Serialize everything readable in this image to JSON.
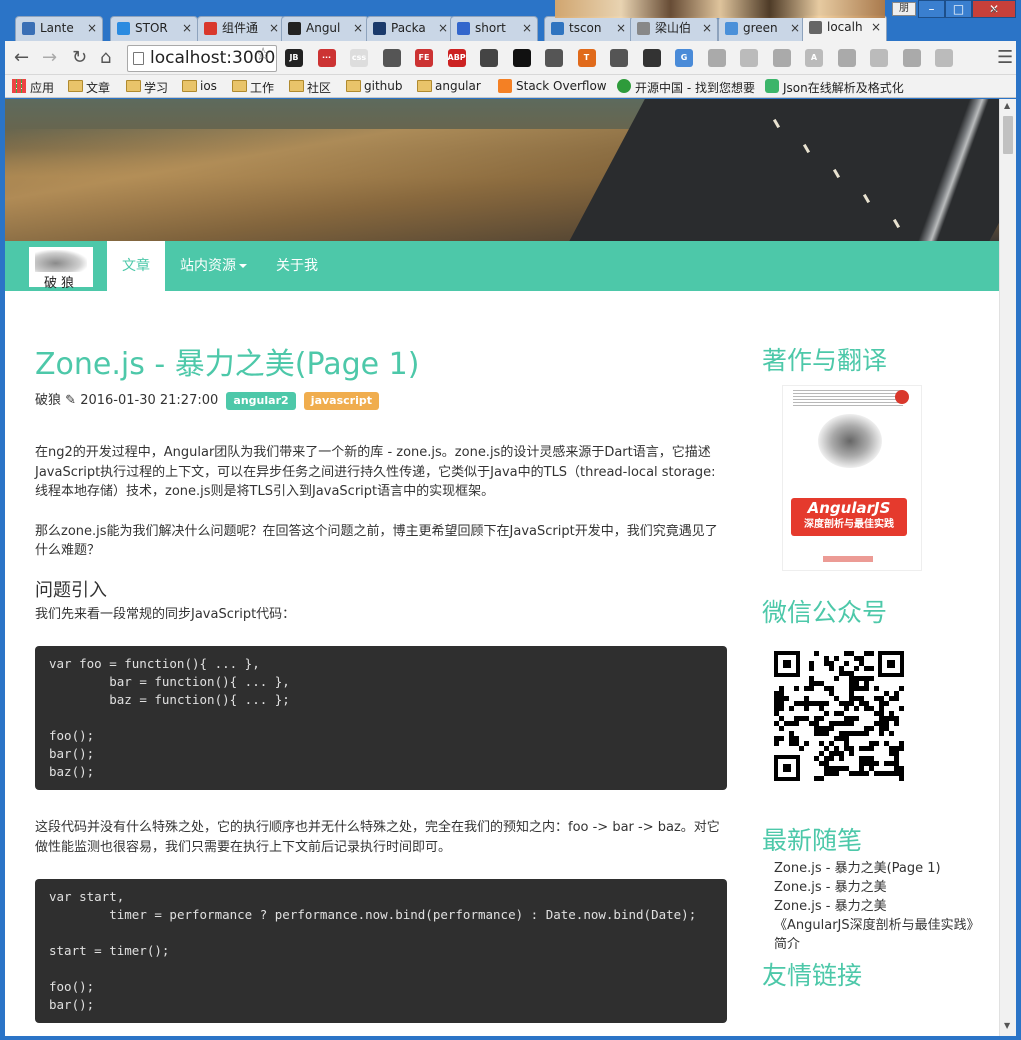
{
  "browser": {
    "tabs": [
      {
        "label": "Lante",
        "icon": "arrow-up-icon",
        "color": "#3a6fb5"
      },
      {
        "label": "STOR",
        "icon": "store-icon",
        "color": "#2b8be0"
      },
      {
        "label": "组件通",
        "icon": "angular-icon",
        "color": "#d9382c"
      },
      {
        "label": "Angul",
        "icon": "github-icon",
        "color": "#222222"
      },
      {
        "label": "Packa",
        "icon": "n-icon",
        "color": "#1b3a6b"
      },
      {
        "label": "short",
        "icon": "paw-icon",
        "color": "#3366cc"
      },
      {
        "label": "tscon",
        "icon": "ts-icon",
        "color": "#2f74c0"
      },
      {
        "label": "梁山伯",
        "icon": "page-icon",
        "color": "#888888"
      },
      {
        "label": "green",
        "icon": "c-icon",
        "color": "#4a90d9"
      },
      {
        "label": "localh",
        "icon": "wolf-icon",
        "color": "#666666"
      }
    ],
    "active_tab": 9,
    "address": "localhost:3000",
    "user_label": "朋",
    "window_buttons": {
      "min": "–",
      "max": "□",
      "close": "✕"
    },
    "bookmarks": [
      {
        "label": "应用",
        "icon": "apps-grid-icon"
      },
      {
        "label": "文章",
        "icon": "folder-icon"
      },
      {
        "label": "学习",
        "icon": "folder-icon"
      },
      {
        "label": "ios",
        "icon": "folder-icon"
      },
      {
        "label": "工作",
        "icon": "folder-icon"
      },
      {
        "label": "社区",
        "icon": "folder-icon"
      },
      {
        "label": "github",
        "icon": "folder-icon"
      },
      {
        "label": "angular",
        "icon": "folder-icon"
      },
      {
        "label": "Stack Overflow",
        "icon": "stackoverflow-icon"
      },
      {
        "label": "开源中国 - 找到您想要",
        "icon": "oschina-icon"
      },
      {
        "label": "Json在线解析及格式化",
        "icon": "json-icon"
      }
    ],
    "bookmarks_more": "»",
    "extensions": [
      "JB",
      "···",
      "css",
      "",
      "FE",
      "ABP",
      "",
      "",
      "",
      "T",
      "",
      "",
      "G",
      "",
      "",
      "",
      "A",
      "",
      "",
      "",
      ""
    ]
  },
  "site": {
    "logo_text": "破狼",
    "nav": [
      {
        "label": "文章",
        "active": true
      },
      {
        "label": "站内资源",
        "dropdown": true
      },
      {
        "label": "关于我"
      }
    ],
    "accent": "#4dc8a9"
  },
  "article": {
    "title": "Zone.js - 暴力之美(Page 1)",
    "author": "破狼",
    "date": "2016-01-30 21:27:00",
    "tags": [
      "angular2",
      "javascript"
    ],
    "p1": "在ng2的开发过程中，Angular团队为我们带来了一个新的库 - zone.js。zone.js的设计灵感来源于Dart语言，它描述JavaScript执行过程的上下文，可以在异步任务之间进行持久性传递，它类似于Java中的TLS（thread-local storage: 线程本地存储）技术，zone.js则是将TLS引入到JavaScript语言中的实现框架。",
    "p2": "那么zone.js能为我们解决什么问题呢？在回答这个问题之前，博主更希望回顾下在JavaScript开发中，我们究竟遇见了什么难题？",
    "h_problem": "问题引入",
    "p3": "我们先来看一段常规的同步JavaScript代码：",
    "code1": "var foo = function(){ ... },\n        bar = function(){ ... },\n        baz = function(){ ... };\n\nfoo();\nbar();\nbaz();",
    "p4": "这段代码并没有什么特殊之处，它的执行顺序也并无什么特殊之处，完全在我们的预知之内：foo -> bar -> baz。对它做性能监测也很容易，我们只需要在执行上下文前后记录执行时间即可。",
    "code2": "var start,\n        timer = performance ? performance.now.bind(performance) : Date.now.bind(Date);\n\nstart = timer();\n\nfoo();\nbar();"
  },
  "sidebar": {
    "books_title": "著作与翻译",
    "book_cover_title": "AngularJS",
    "book_cover_subtitle": "深度剖析与最佳实践",
    "wechat_title": "微信公众号",
    "recent_title": "最新随笔",
    "recent": [
      "Zone.js - 暴力之美(Page 1)",
      "Zone.js - 暴力之美",
      "Zone.js - 暴力之美",
      "《AngularJS深度剖析与最佳实践》简介"
    ],
    "links_title": "友情链接"
  }
}
